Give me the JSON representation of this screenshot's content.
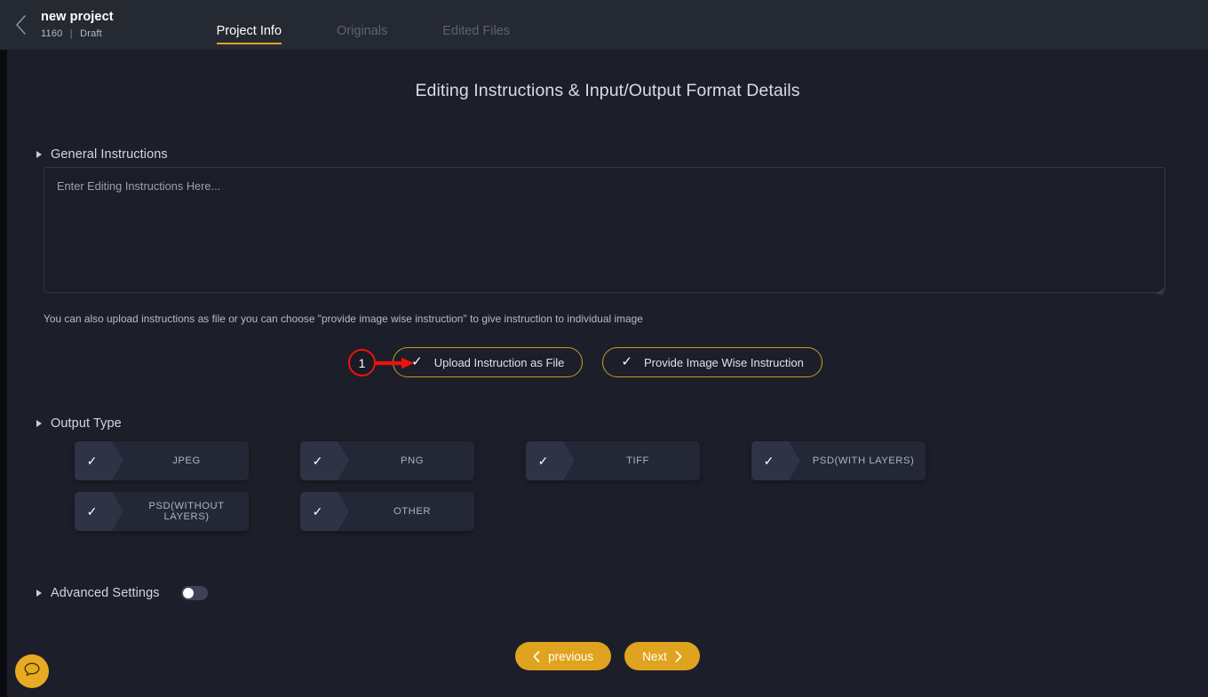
{
  "header": {
    "back_icon": "chevron-left-icon",
    "project_title": "new project",
    "project_id": "1160",
    "separator": "|",
    "project_status": "Draft",
    "tabs": [
      {
        "label": "Project Info",
        "active": true
      },
      {
        "label": "Originals",
        "active": false
      },
      {
        "label": "Edited Files",
        "active": false
      }
    ]
  },
  "main": {
    "page_title": "Editing Instructions & Input/Output Format Details",
    "general_instructions": {
      "section_label": "General Instructions",
      "textarea_value": "",
      "textarea_placeholder": "Enter Editing Instructions Here...",
      "hint": "You can also upload instructions as file or you can choose \"provide image wise instruction\" to give instruction to individual image",
      "buttons": [
        {
          "label": "Upload Instruction as File",
          "icon": "check-icon"
        },
        {
          "label": "Provide Image Wise Instruction",
          "icon": "check-icon"
        }
      ]
    },
    "output_type": {
      "section_label": "Output Type",
      "options": [
        {
          "label": "JPEG",
          "icon": "check-icon"
        },
        {
          "label": "PNG",
          "icon": "check-icon"
        },
        {
          "label": "TIFF",
          "icon": "check-icon"
        },
        {
          "label": "PSD(WITH LAYERS)",
          "icon": "check-icon"
        },
        {
          "label": "PSD(WITHOUT LAYERS)",
          "icon": "check-icon"
        },
        {
          "label": "OTHER",
          "icon": "check-icon"
        }
      ]
    },
    "advanced_settings": {
      "section_label": "Advanced Settings",
      "toggle_on": false
    },
    "navigation": {
      "previous_label": "previous",
      "next_label": "Next",
      "prev_icon": "chevron-left-icon",
      "next_icon": "chevron-right-icon"
    }
  },
  "chat_widget": {
    "icon": "chat-bubble-icon"
  },
  "annotation": {
    "number": "1",
    "target": "Upload Instruction as File",
    "color": "#ef1010"
  },
  "colors": {
    "accent": "#e0a526",
    "accent_solid": "#e0a31f",
    "header_bg": "#252932",
    "panel_bg": "#1c1f29",
    "chip_bg": "#232736",
    "chip_flag_bg": "#2e3346",
    "annotation_red": "#ef1010"
  }
}
